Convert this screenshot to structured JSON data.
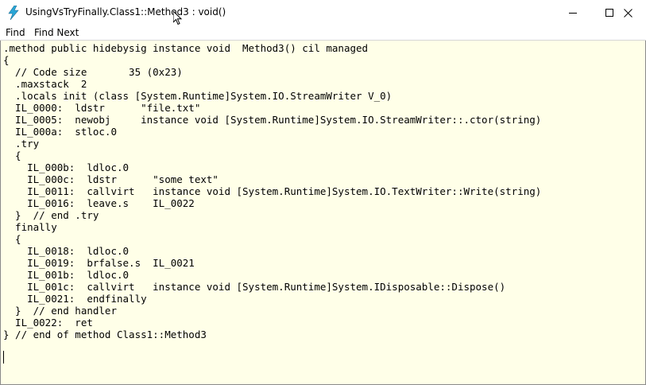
{
  "window": {
    "title": "UsingVsTryFinally.Class1::Method3 : void()",
    "icon": "lightning-bolt-icon",
    "controls": [
      "minimize-icon",
      "maximize-icon",
      "close-icon"
    ]
  },
  "menu": {
    "items": [
      {
        "label": "Find"
      },
      {
        "label": "Find Next"
      }
    ]
  },
  "editor": {
    "background": "#ffffe8",
    "lines": [
      ".method public hidebysig instance void  Method3() cil managed",
      "{",
      "  // Code size       35 (0x23)",
      "  .maxstack  2",
      "  .locals init (class [System.Runtime]System.IO.StreamWriter V_0)",
      "  IL_0000:  ldstr      \"file.txt\"",
      "  IL_0005:  newobj     instance void [System.Runtime]System.IO.StreamWriter::.ctor(string)",
      "  IL_000a:  stloc.0",
      "  .try",
      "  {",
      "    IL_000b:  ldloc.0",
      "    IL_000c:  ldstr      \"some text\"",
      "    IL_0011:  callvirt   instance void [System.Runtime]System.IO.TextWriter::Write(string)",
      "    IL_0016:  leave.s    IL_0022",
      "  }  // end .try",
      "  finally",
      "  {",
      "    IL_0018:  ldloc.0",
      "    IL_0019:  brfalse.s  IL_0021",
      "    IL_001b:  ldloc.0",
      "    IL_001c:  callvirt   instance void [System.Runtime]System.IDisposable::Dispose()",
      "    IL_0021:  endfinally",
      "  }  // end handler",
      "  IL_0022:  ret",
      "} // end of method Class1::Method3"
    ]
  }
}
